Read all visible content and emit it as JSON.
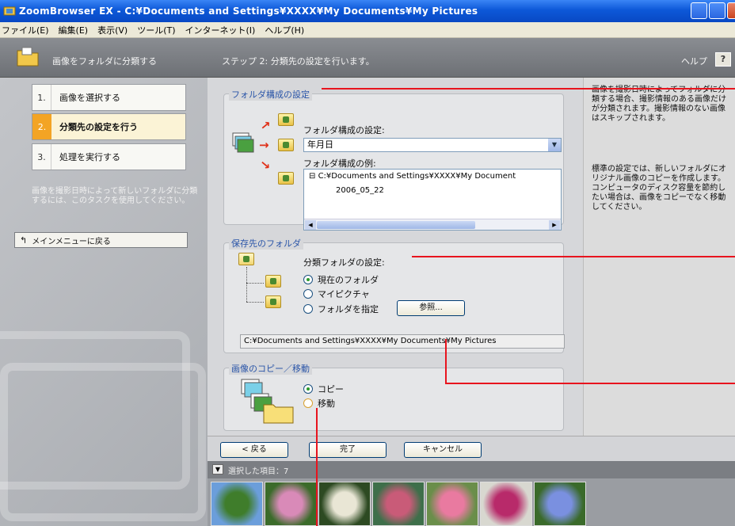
{
  "window": {
    "title": "ZoomBrowser EX  -  C:¥Documents and Settings¥XXXX¥My Documents¥My Pictures"
  },
  "menu": [
    "ファイル(E)",
    "編集(E)",
    "表示(V)",
    "ツール(T)",
    "インターネット(I)",
    "ヘルプ(H)"
  ],
  "header": {
    "task": "画像をフォルダに分類する",
    "step": "ステップ 2: 分類先の設定を行います。",
    "help": "ヘルプ",
    "help_icon": "?"
  },
  "steps": [
    {
      "num": "1.",
      "label": "画像を選択する",
      "active": false
    },
    {
      "num": "2.",
      "label": "分類先の設定を行う",
      "active": true
    },
    {
      "num": "3.",
      "label": "処理を実行する",
      "active": false
    }
  ],
  "left_description": "画像を撮影日時によって新しいフォルダに分類するには、このタスクを使用してください。",
  "back_to_main": "メインメニューに戻る",
  "folder_structure": {
    "title": "フォルダ構成の設定",
    "setting_label": "フォルダ構成の設定:",
    "setting_value": "年月日",
    "example_label": "フォルダ構成の例:",
    "example_path": "C:¥Documents and Settings¥XXXX¥My Document",
    "example_sub": "2006_05_22"
  },
  "save_folder": {
    "title": "保存先のフォルダ",
    "label": "分類フォルダの設定:",
    "options": [
      "現在のフォルダ",
      "マイピクチャ",
      "フォルダを指定"
    ],
    "selected": 0,
    "browse": "参照...",
    "path": "C:¥Documents and Settings¥XXXX¥My Documents¥My Pictures"
  },
  "copy_move": {
    "title": "画像のコピー／移動",
    "options": [
      "コピー",
      "移動"
    ],
    "selected": 0
  },
  "help": {
    "text1": "画像を撮影日時によってフォルダに分類する場合、撮影情報のある画像だけが分類されます。撮影情報のない画像はスキップされます。",
    "text2": "標準の設定では、新しいフォルダにオリジナル画像のコピーを作成します。コンピュータのディスク容量を節約したい場合は、画像をコピーでなく移動してください。"
  },
  "nav": {
    "back": "< 戻る",
    "finish": "完了",
    "cancel": "キャンセル"
  },
  "selected_items": {
    "label": "選択した項目：7"
  },
  "thumbnails": [
    {
      "name": "thumb-1",
      "colors": [
        "#6b9edb",
        "#3f7d2b"
      ]
    },
    {
      "name": "thumb-2",
      "colors": [
        "#3b6b2a",
        "#d98ab8"
      ]
    },
    {
      "name": "thumb-3",
      "colors": [
        "#2d4a22",
        "#e9e6d5"
      ]
    },
    {
      "name": "thumb-4",
      "colors": [
        "#3e6f4a",
        "#c95b78"
      ]
    },
    {
      "name": "thumb-5",
      "colors": [
        "#6a8e4a",
        "#e97aa0"
      ]
    },
    {
      "name": "thumb-6",
      "colors": [
        "#d8d8d0",
        "#b82a6a"
      ]
    },
    {
      "name": "thumb-7",
      "colors": [
        "#3a6a2a",
        "#7a90e0"
      ]
    }
  ]
}
